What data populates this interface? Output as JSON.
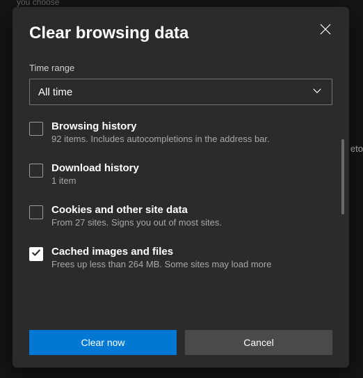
{
  "background": {
    "hint_text": "you choose",
    "right_text": "eto"
  },
  "modal": {
    "title": "Clear browsing data",
    "time_range_label": "Time range",
    "time_range_value": "All time",
    "items": [
      {
        "title": "Browsing history",
        "desc": "92 items. Includes autocompletions in the address bar.",
        "checked": false
      },
      {
        "title": "Download history",
        "desc": "1 item",
        "checked": false
      },
      {
        "title": "Cookies and other site data",
        "desc": "From 27 sites. Signs you out of most sites.",
        "checked": false
      },
      {
        "title": "Cached images and files",
        "desc": "Frees up less than 264 MB. Some sites may load more",
        "checked": true
      }
    ],
    "primary_button": "Clear now",
    "secondary_button": "Cancel"
  },
  "colors": {
    "accent": "#0078d4",
    "modal_bg": "#2b2b2b"
  }
}
